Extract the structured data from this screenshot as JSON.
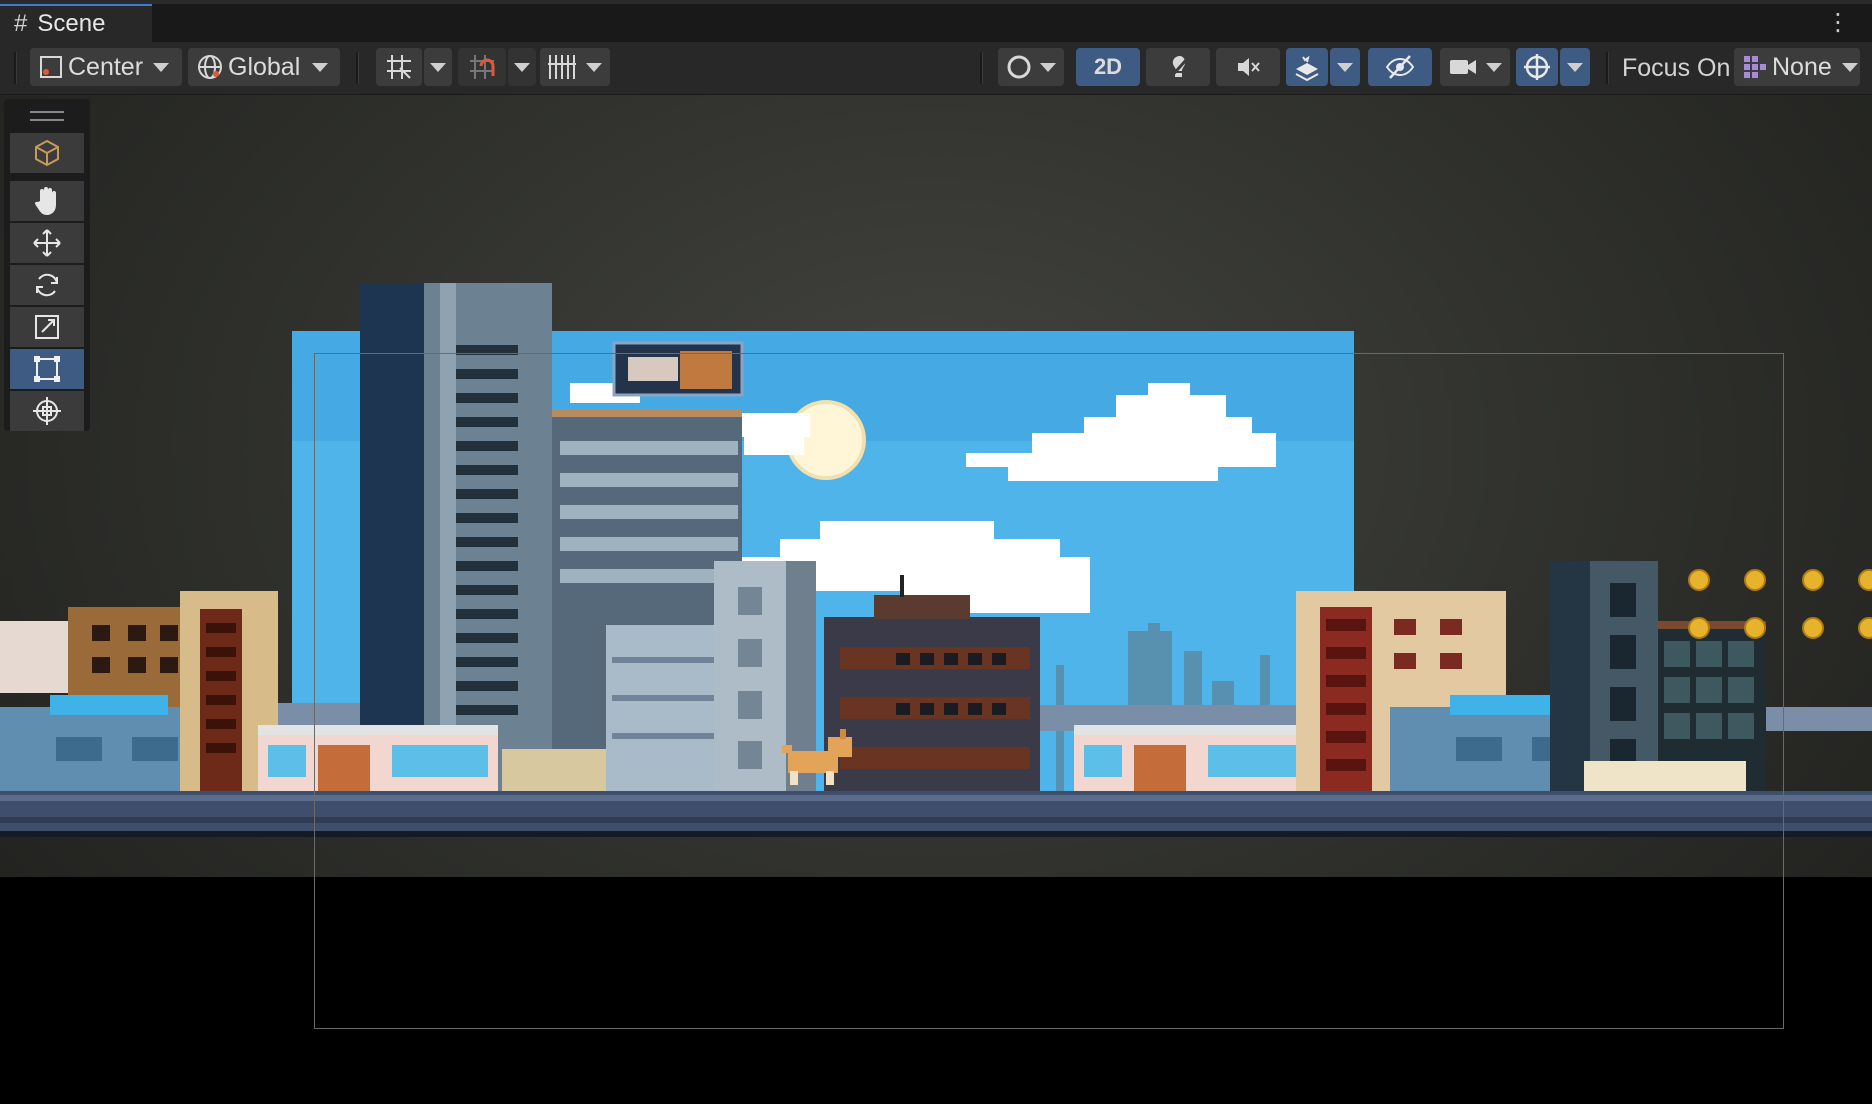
{
  "tab": {
    "title": "Scene"
  },
  "toolbar": {
    "pivot_mode": "Center",
    "pivot_rotation": "Global",
    "mode_2d": "2D",
    "focus_label": "Focus On",
    "focus_value": "None"
  },
  "tools": [
    {
      "name": "view-tool",
      "icon": "hand-icon"
    },
    {
      "name": "move-tool",
      "icon": "move-arrows-icon"
    },
    {
      "name": "rotate-tool",
      "icon": "rotate-icon"
    },
    {
      "name": "scale-tool",
      "icon": "scale-icon"
    },
    {
      "name": "rect-tool",
      "icon": "rect-transform-icon"
    },
    {
      "name": "transform-tool",
      "icon": "transform-icon"
    }
  ],
  "colors": {
    "accent": "#3e5b84",
    "sky": "#4fb4ea",
    "toolbar": "#282828"
  }
}
